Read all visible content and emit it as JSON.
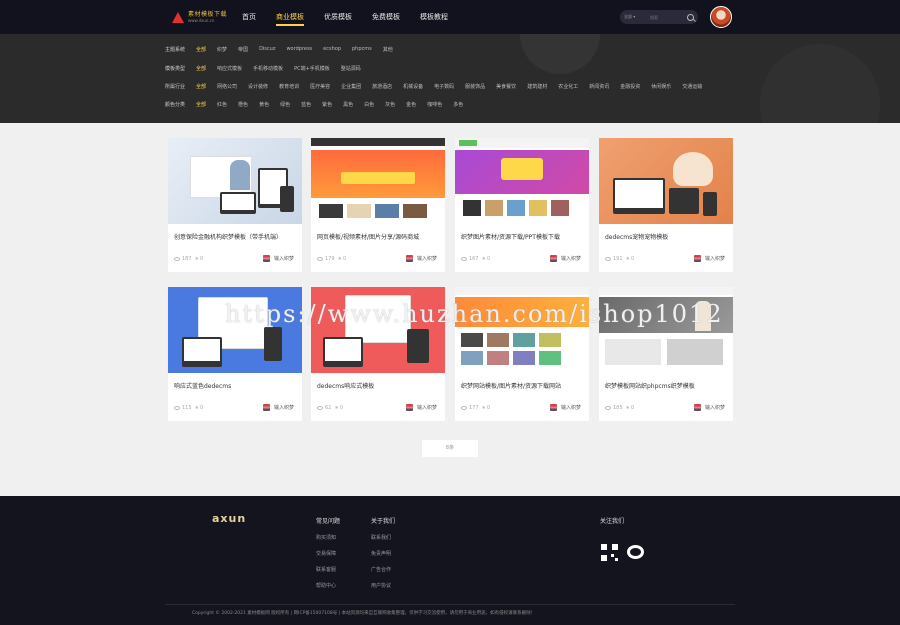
{
  "header": {
    "logo_text": "素材模板下载",
    "logo_sub": "www.ilxun.cn",
    "nav": [
      "首页",
      "商业模板",
      "优质模板",
      "免费模板",
      "模板教程"
    ],
    "search_select": "全部",
    "search_placeholder": "搜索"
  },
  "filters": {
    "row1": {
      "label": "主题系统",
      "items": [
        "全部",
        "织梦",
        "帝国",
        "Discuz",
        "wordpress",
        "ecshop",
        "phpcms",
        "其他"
      ]
    },
    "row2": {
      "label": "模板类型",
      "items": [
        "全部",
        "响应式模板",
        "手机移动模板",
        "PC端+手机模板",
        "整站源码"
      ]
    },
    "row3": {
      "label": "所属行业",
      "items": [
        "全部",
        "网络公司",
        "设计装修",
        "教育培训",
        "医疗美容",
        "企业集团",
        "旅游酒店",
        "机械设备",
        "电子数码",
        "服装饰品",
        "美食餐饮",
        "建筑建材",
        "农业化工",
        "新闻资讯",
        "金融投资",
        "休闲娱乐",
        "交通运输"
      ]
    },
    "row4": {
      "label": "颜色分类",
      "items": [
        "全部",
        "红色",
        "橙色",
        "黄色",
        "绿色",
        "蓝色",
        "紫色",
        "黑色",
        "白色",
        "灰色",
        "金色",
        "咖啡色",
        "多色"
      ]
    }
  },
  "cards": [
    {
      "title": "创意保险金融机构织梦模板（带手机端）",
      "views": "187",
      "likes": "0",
      "download": "输入织梦"
    },
    {
      "title": "网页模板/视频素材/图片分享/源码商城",
      "views": "179",
      "likes": "0",
      "download": "输入织梦"
    },
    {
      "title": "织梦图片素材/资源下载/PPT模板下载",
      "views": "167",
      "likes": "0",
      "download": "输入织梦"
    },
    {
      "title": "dedecms宠物宠物模板",
      "views": "191",
      "likes": "0",
      "download": "输入织梦"
    },
    {
      "title": "响应式蓝色dedecms",
      "views": "115",
      "likes": "0",
      "download": "输入织梦"
    },
    {
      "title": "dedecms响应式模板",
      "views": "62",
      "likes": "0",
      "download": "输入织梦"
    },
    {
      "title": "织梦网站模板/图片素材/资源下载网站",
      "views": "177",
      "likes": "0",
      "download": "输入织梦"
    },
    {
      "title": "织梦模板网站织phpcms织梦模板",
      "views": "185",
      "likes": "0",
      "download": "输入织梦"
    }
  ],
  "pager_label": "8条",
  "footer": {
    "logo": "axun",
    "col1": {
      "title": "常见问题",
      "items": [
        "购买须知",
        "交易保障",
        "联系客服",
        "帮助中心"
      ]
    },
    "col2": {
      "title": "关于我们",
      "items": [
        "联系我们",
        "免责声明",
        "广告合作",
        "用户协议"
      ]
    },
    "col3": {
      "title": "关注我们"
    },
    "copyright": "Copyright © 2002-2021 素材模板网 版权所有 | 网ICP备15007108号 | 本站资源均来自互联网收集整理，仅供学习交流使用，请勿用于商业用途，如有侵权请联系删除！"
  },
  "watermark": "https://www.huzhan.com/ishop1012"
}
